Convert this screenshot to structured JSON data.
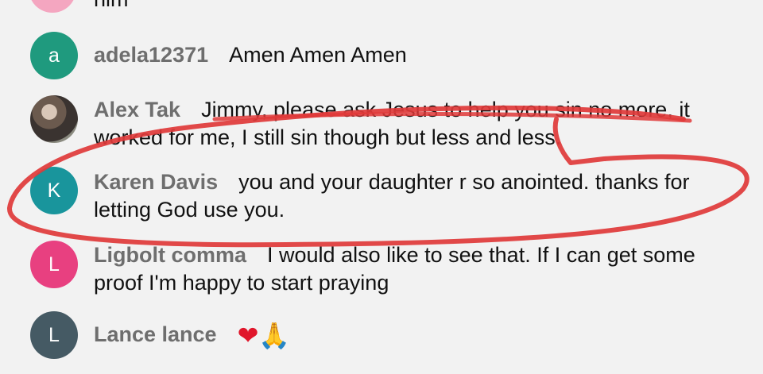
{
  "top_fragment": "him",
  "comments": [
    {
      "avatar_letter": "a",
      "avatar_color": "#1f9a7e",
      "username": "adela12371",
      "text": "Amen Amen Amen"
    },
    {
      "avatar_letter": "",
      "avatar_color": "#8a8a8a",
      "username": "Alex Tak",
      "text": "Jimmy, please ask Jesus to help you sin no more, it worked for me, I still sin though but less and less."
    },
    {
      "avatar_letter": "K",
      "avatar_color": "#19959c",
      "username": "Karen Davis",
      "text": "you and your daughter r so anointed. thanks for letting God use you."
    },
    {
      "avatar_letter": "L",
      "avatar_color": "#e84080",
      "username": "Ligbolt comma",
      "text": "I would also like to see that. If I can get some proof I'm happy to start praying"
    },
    {
      "avatar_letter": "L",
      "avatar_color": "#455a64",
      "username": "Lance lance",
      "text": "",
      "emojis": [
        "heart",
        "folded-hands"
      ]
    }
  ],
  "annotation_color": "#e03a3a"
}
